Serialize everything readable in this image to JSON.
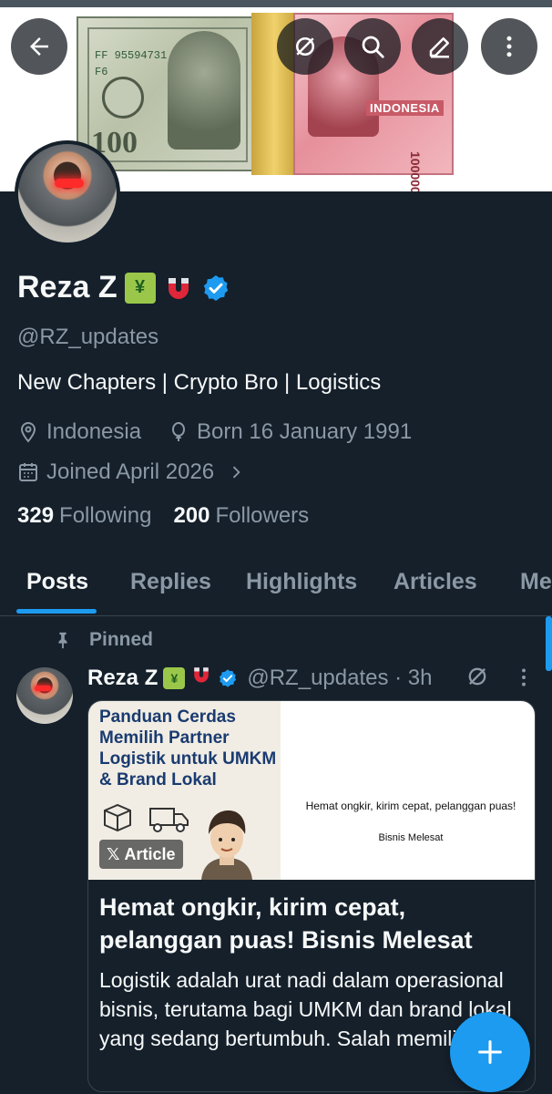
{
  "header": {
    "back_icon": "arrow-left-icon",
    "grok_icon": "grok-icon",
    "search_icon": "search-icon",
    "compose_icon": "pencil-icon",
    "more_icon": "more-vertical-icon"
  },
  "banner": {
    "usd_serial_1": "FF 95594731 A",
    "usd_serial_2": "F6",
    "usd_denomination": "100",
    "idr_country": "INDONESIA",
    "idr_denomination": "100000"
  },
  "profile": {
    "name": "Reza Z",
    "emoji_chart": "¥",
    "handle": "@RZ_updates",
    "bio": "New Chapters | Crypto Bro | Logistics",
    "location": "Indonesia",
    "birthday": "Born 16 January 1991",
    "joined": "Joined April 2026",
    "following_count": "329",
    "following_label": "Following",
    "followers_count": "200",
    "followers_label": "Followers"
  },
  "tabs": [
    "Posts",
    "Replies",
    "Highlights",
    "Articles",
    "Me"
  ],
  "active_tab": "Posts",
  "post": {
    "pinned_label": "Pinned",
    "author_name": "Reza Z",
    "author_handle": "@RZ_updates · 3h",
    "card": {
      "image_title": "Panduan Cerdas Memilih Partner Logistik untuk UMKM & Brand Lokal",
      "badge": "Article",
      "image_text_1": "Hemat ongkir, kirim cepat, pelanggan puas!",
      "image_text_2": "Bisnis Melesat",
      "title": "Hemat ongkir, kirim cepat, pelanggan puas! Bisnis Melesat",
      "body": "Logistik adalah urat nadi dalam operasional bisnis, terutama bagi UMKM dan brand lokal yang sedang bertumbuh. Salah memilih"
    }
  },
  "colors": {
    "background": "#15202b",
    "accent": "#1d9bf0",
    "muted_text": "#8b98a5",
    "primary_text": "#f7f9f9"
  }
}
